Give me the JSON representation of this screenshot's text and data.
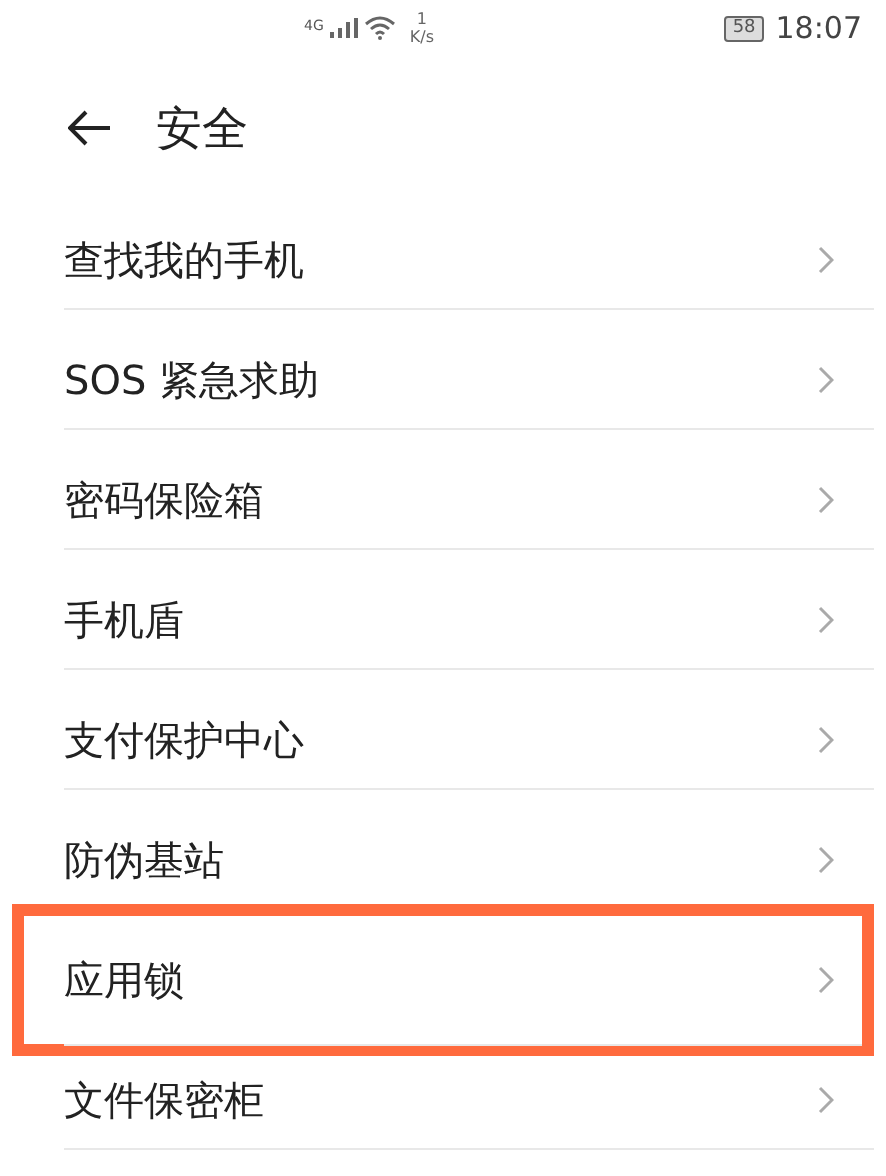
{
  "status_bar": {
    "network": "4G",
    "speed_value": "1",
    "speed_unit": "K/s",
    "battery": "58",
    "time": "18:07"
  },
  "header": {
    "title": "安全"
  },
  "items": [
    {
      "label": "查找我的手机",
      "highlighted": false
    },
    {
      "label": "SOS 紧急求助",
      "highlighted": false
    },
    {
      "label": "密码保险箱",
      "highlighted": false
    },
    {
      "label": "手机盾",
      "highlighted": false
    },
    {
      "label": "支付保护中心",
      "highlighted": false
    },
    {
      "label": "防伪基站",
      "highlighted": false
    },
    {
      "label": "应用锁",
      "highlighted": true
    },
    {
      "label": "文件保密柜",
      "highlighted": false
    }
  ]
}
